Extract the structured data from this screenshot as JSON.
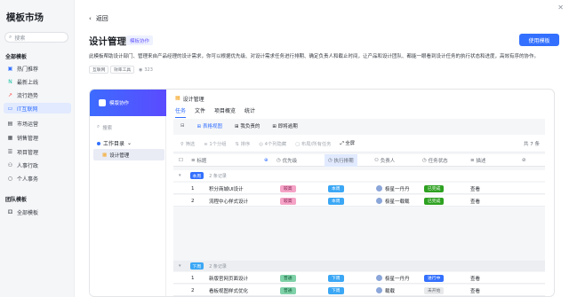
{
  "sidebar": {
    "title": "模板市场",
    "search_placeholder": "搜索",
    "group_all": "全部模板",
    "items": [
      {
        "label": "热门推荐",
        "icon": "thumbs-up-icon",
        "color": "#3370ff"
      },
      {
        "label": "最新上线",
        "icon": "new-icon",
        "color": "#14c0a0"
      },
      {
        "label": "流行趋势",
        "icon": "trend-icon",
        "color": "#f54a45"
      },
      {
        "label": "IT互联网",
        "icon": "code-icon",
        "color": "#3370ff"
      },
      {
        "label": "市场运营",
        "icon": "chart-icon",
        "color": "#646a73"
      },
      {
        "label": "销售管理",
        "icon": "grid-icon",
        "color": "#646a73"
      },
      {
        "label": "项目管理",
        "icon": "list-icon",
        "color": "#646a73"
      },
      {
        "label": "人事行政",
        "icon": "people-icon",
        "color": "#646a73"
      },
      {
        "label": "个人事务",
        "icon": "person-icon",
        "color": "#646a73"
      }
    ],
    "group_team": "团队模板",
    "team_items": [
      {
        "label": "全部模板",
        "icon": "team-icon"
      }
    ]
  },
  "header": {
    "back_label": "返回",
    "title": "设计管理",
    "badge": "模板协作",
    "use_button": "使用模板",
    "description": "此模板帮助设计部门、管理来自产品经理的设计需求，你可以根据优先级、对设计需求任务进行排期、确定负责人和截止时间，让产品和设计团队、都能一眼看到设计任务的执行状态和进度，高效有序的协作。",
    "tags": [
      "互联网",
      "效率工具"
    ],
    "views": "323"
  },
  "preview": {
    "brand": "模版协作",
    "search": "搜索",
    "directory": "工作目录",
    "table_item": "设计管理",
    "doc_title": "设计管理",
    "tabs": [
      "任务",
      "文件",
      "项目概览",
      "统计"
    ],
    "views": [
      "表格视图",
      "我负责的",
      "即将逾期"
    ],
    "toolbar": [
      "筛选",
      "1个分组",
      "排序",
      "4个列隐藏",
      "布局/所有任务",
      "全屏"
    ],
    "total": "共 7 条",
    "columns": [
      "标题",
      "优先级",
      "执行排期",
      "负责人",
      "任务状态",
      "描述"
    ],
    "groups": [
      {
        "label": "本周",
        "count": "2 条记录",
        "rows": [
          {
            "index": "1",
            "title": "积分商城UI设计",
            "priority": "较高",
            "priority_color": "#f5a3c7",
            "schedule": "本周",
            "owner": "极星一丹丹",
            "status": "已完成",
            "status_color": "#2ea121",
            "desc": "查看"
          },
          {
            "index": "2",
            "title": "流程中心样式设计",
            "priority": "较高",
            "priority_color": "#f5a3c7",
            "schedule": "本周",
            "owner": "极星一载载",
            "status": "已完成",
            "status_color": "#2ea121",
            "desc": "查看"
          }
        ]
      },
      {
        "label": "下周",
        "count": "2 条记录",
        "rows": [
          {
            "index": "1",
            "title": "新版官网页面设计",
            "priority": "普通",
            "priority_color": "#7fd1a8",
            "schedule": "下周",
            "owner": "极星一丹丹",
            "status": "进行中",
            "status_color": "#3370ff",
            "desc": "查看"
          },
          {
            "index": "2",
            "title": "看板视图样式优化",
            "priority": "普通",
            "priority_color": "#7fd1a8",
            "schedule": "下周",
            "owner": "载载",
            "status": "未开始",
            "status_color": "#d9dbde",
            "desc": "查看"
          }
        ]
      }
    ]
  }
}
